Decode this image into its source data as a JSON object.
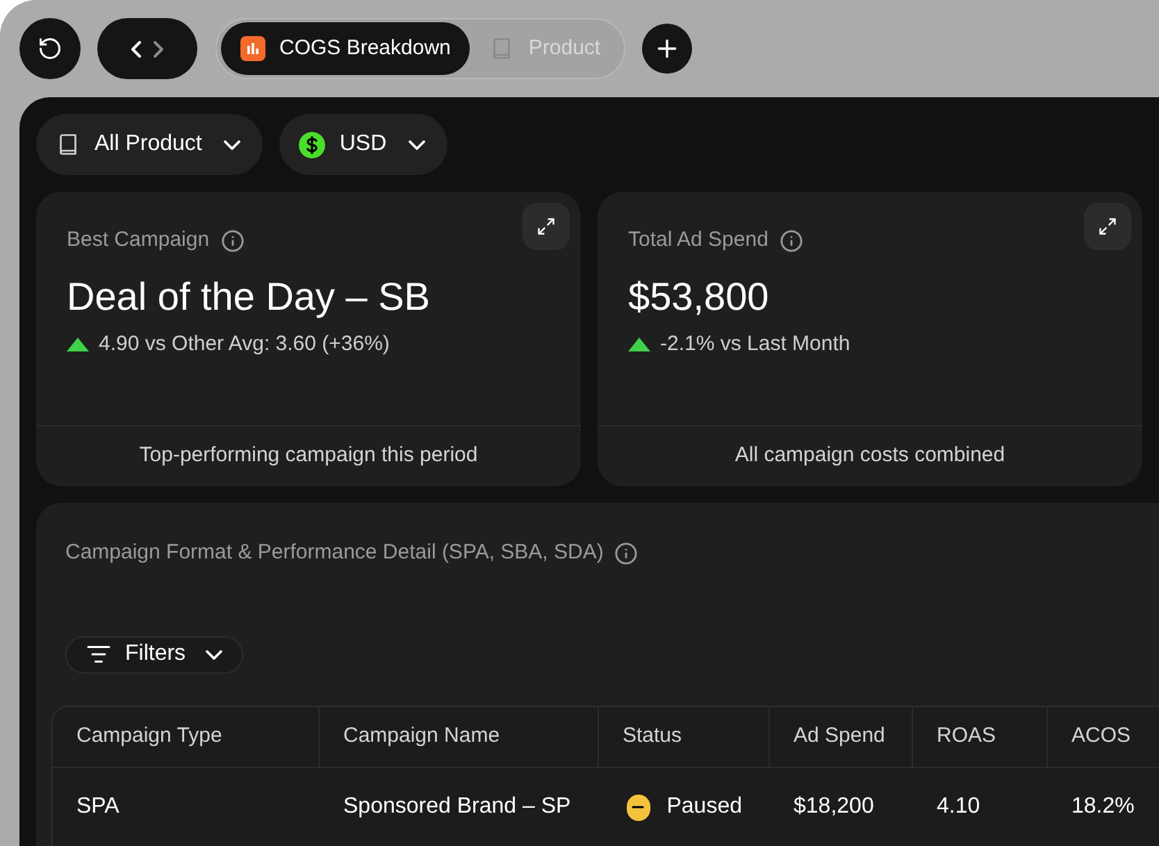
{
  "tabs": [
    {
      "label": "COGS Breakdown",
      "selected": true,
      "kind": "chart"
    },
    {
      "label": "Product",
      "selected": false,
      "kind": "book"
    }
  ],
  "filters": [
    {
      "label": "All Product",
      "kind": "book"
    },
    {
      "label": "USD",
      "kind": "dollar"
    }
  ],
  "cards": [
    {
      "title": "Best Campaign",
      "value": "Deal of the Day – SB",
      "kind": "up",
      "delta": "4.90 vs Other Avg: 3.60 (+36%)",
      "footer": "Top-performing campaign this period"
    },
    {
      "title": "Total Ad Spend",
      "value": "$53,800",
      "kind": "up",
      "delta": "-2.1% vs Last Month",
      "footer": "All campaign costs combined"
    }
  ],
  "table_section": {
    "title": "Campaign Format & Performance Detail (SPA, SBA, SDA)",
    "filter_button": "Filters",
    "columns": [
      "Campaign Type",
      "Campaign Name",
      "Status",
      "Ad Spend",
      "ROAS",
      "ACOS"
    ],
    "rows": [
      {
        "type": "SPA",
        "name": "Sponsored Brand – SP",
        "status": {
          "label": "Paused",
          "kind": "paused",
          "color": "#f5c33b"
        },
        "ad_spend": "$18,200",
        "roas": "4.10",
        "acos": "18.2%"
      }
    ]
  }
}
